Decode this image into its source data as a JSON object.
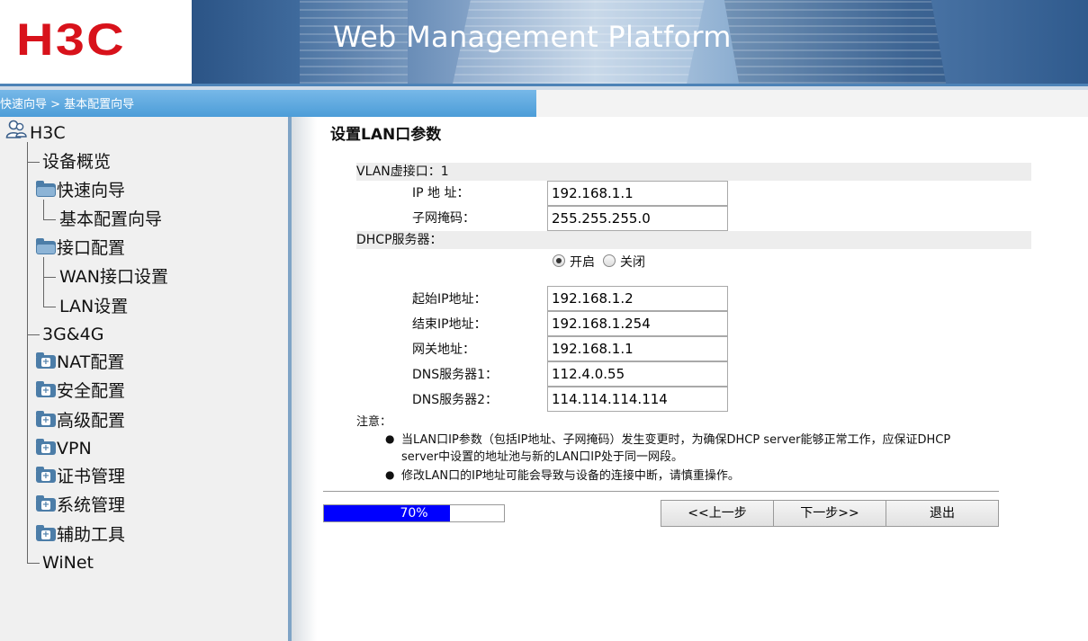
{
  "header": {
    "logo": "H3C",
    "title": "Web Management Platform"
  },
  "breadcrumb": "快速向导 > 基本配置向导",
  "sidebar": {
    "root": "H3C",
    "items": [
      {
        "label": "设备概览"
      },
      {
        "label": "快速向导"
      },
      {
        "label": "基本配置向导"
      },
      {
        "label": "接口配置"
      },
      {
        "label": "WAN接口设置"
      },
      {
        "label": "LAN设置"
      },
      {
        "label": "3G&4G"
      },
      {
        "label": "NAT配置"
      },
      {
        "label": "安全配置"
      },
      {
        "label": "高级配置"
      },
      {
        "label": "VPN"
      },
      {
        "label": "证书管理"
      },
      {
        "label": "系统管理"
      },
      {
        "label": "辅助工具"
      },
      {
        "label": "WiNet"
      }
    ]
  },
  "main": {
    "title": "设置LAN口参数",
    "vlan_label": "VLAN虚接口：1",
    "ip_label": "IP 地 址：",
    "ip_value": "192.168.1.1",
    "mask_label": "子网掩码：",
    "mask_value": "255.255.255.0",
    "dhcp_label": "DHCP服务器：",
    "dhcp_on_label": "开启",
    "dhcp_off_label": "关闭",
    "dhcp_enabled": true,
    "start_ip_label": "起始IP地址：",
    "start_ip_value": "192.168.1.2",
    "end_ip_label": "结束IP地址：",
    "end_ip_value": "192.168.1.254",
    "gateway_label": "网关地址：",
    "gateway_value": "192.168.1.1",
    "dns1_label": "DNS服务器1：",
    "dns1_value": "112.4.0.55",
    "dns2_label": "DNS服务器2：",
    "dns2_value": "114.114.114.114",
    "note_label": "注意：",
    "note1_line1": "当LAN口IP参数（包括IP地址、子网掩码）发生变更时，为确保DHCP server能够正常工作，应保证DHCP",
    "note1_line2": "server中设置的地址池与新的LAN口IP处于同一网段。",
    "note2": "修改LAN口的IP地址可能会导致与设备的连接中断，请慎重操作。",
    "progress_text": "70%",
    "progress_value": 0.7,
    "prev_label": "<<上一步",
    "next_label": "下一步>>",
    "exit_label": "退出"
  },
  "colors": {
    "logo": "#d8121b",
    "breadcrumb_bg": "#5aa8df",
    "progress_fill": "#0000ff"
  }
}
